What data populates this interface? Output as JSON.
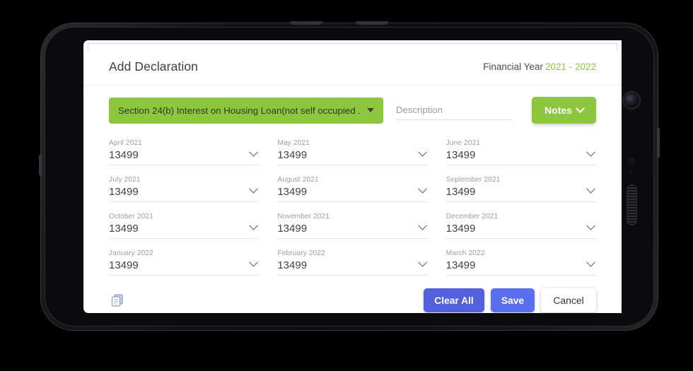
{
  "modal": {
    "title": "Add Declaration",
    "financial_year_label": "Financial Year",
    "financial_year_value": "2021 - 2022",
    "accent_green": "#8dc63f",
    "accent_indigo": "#5a6ff0"
  },
  "controls": {
    "section_select_value": "Section 24(b) Interest on Housing Loan(not self occupied ...",
    "description_placeholder": "Description",
    "description_value": "",
    "notes_label": "Notes"
  },
  "months": [
    {
      "label": "April 2021",
      "value": "13499"
    },
    {
      "label": "May 2021",
      "value": "13499"
    },
    {
      "label": "June 2021",
      "value": "13499"
    },
    {
      "label": "July 2021",
      "value": "13499"
    },
    {
      "label": "August 2021",
      "value": "13499"
    },
    {
      "label": "September 2021",
      "value": "13499"
    },
    {
      "label": "October 2021",
      "value": "13499"
    },
    {
      "label": "November 2021",
      "value": "13499"
    },
    {
      "label": "December 2021",
      "value": "13499"
    },
    {
      "label": "January 2022",
      "value": "13499"
    },
    {
      "label": "February 2022",
      "value": "13499"
    },
    {
      "label": "March 2022",
      "value": "13499"
    }
  ],
  "footer": {
    "copy_icon": "copy-icon",
    "clear_all_label": "Clear All",
    "save_label": "Save",
    "cancel_label": "Cancel"
  }
}
